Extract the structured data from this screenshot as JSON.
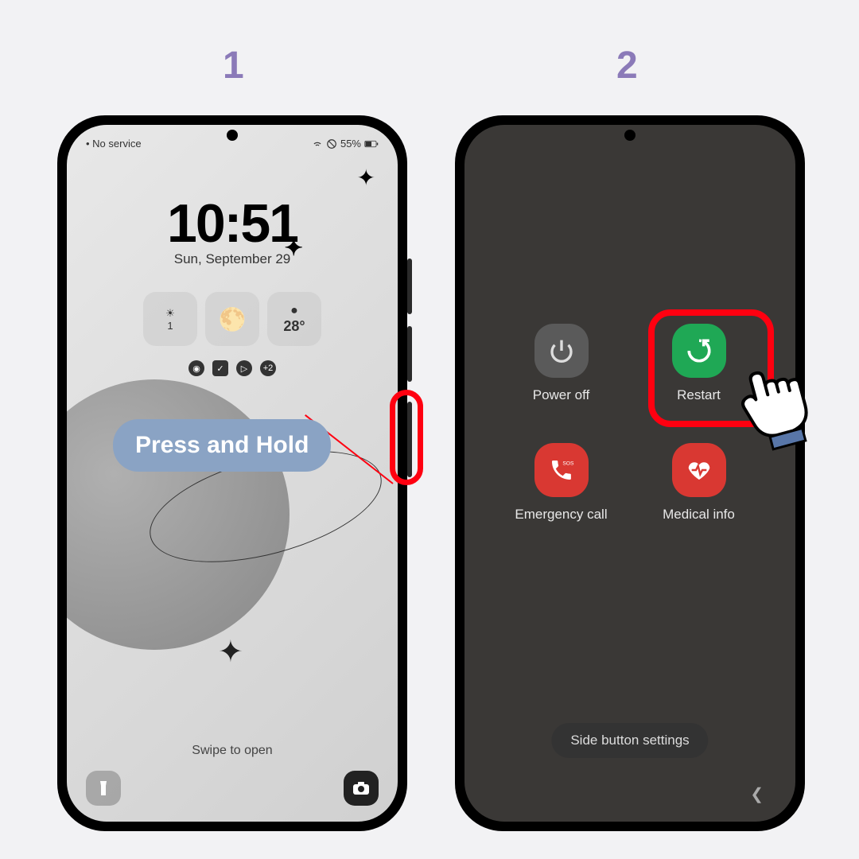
{
  "steps": {
    "one": "1",
    "two": "2"
  },
  "phone1": {
    "status": {
      "left": "• No service",
      "battery": "55%"
    },
    "time": "10:51",
    "date": "Sun, September 29",
    "widgets": {
      "count": "1",
      "temp": "28°"
    },
    "badge": "+2",
    "swipe": "Swipe to open",
    "annotation": "Press and Hold"
  },
  "phone2": {
    "options": {
      "poweroff": "Power off",
      "restart": "Restart",
      "emergency": "Emergency call",
      "medical": "Medical info"
    },
    "sos": "SOS",
    "settings": "Side button settings"
  }
}
